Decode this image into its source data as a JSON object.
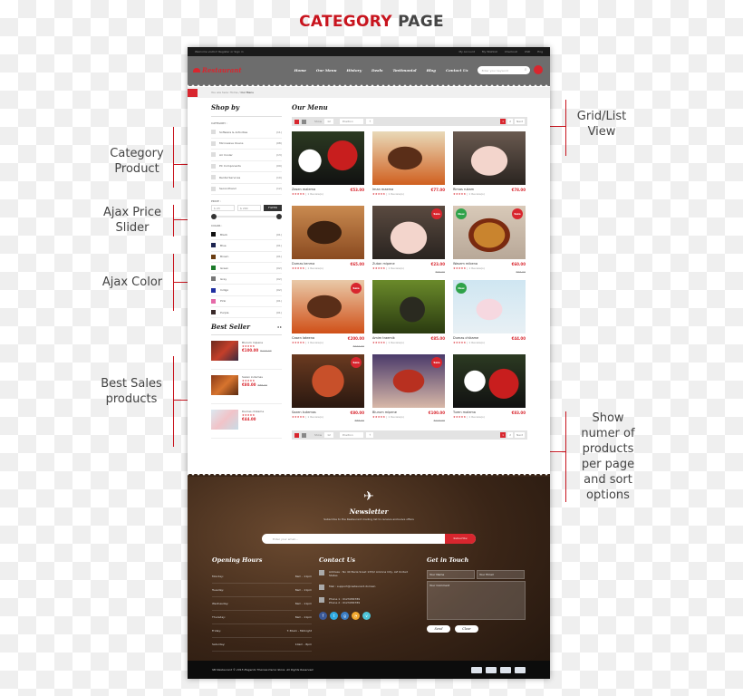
{
  "heading": {
    "part1": "CATEGORY",
    "part2": "PAGE"
  },
  "annotations": {
    "category": "Category Product",
    "price": "Ajax Price Slider",
    "color": "Ajax Color",
    "bestsales": "Best Sales products",
    "gridlist": "Grid/List View",
    "show": "Show numer of products per page and sort options"
  },
  "colors": {
    "accent": "#d8262e",
    "nav": "#6d6d6d",
    "topbar": "#1a1a1a"
  },
  "topbar": {
    "welcome": "Welcome visitor! Register or Sign in",
    "account": "My Account",
    "wishlist": "My Wishlist",
    "checkout": "Checkout",
    "currency": "USD",
    "language": "Eng"
  },
  "header": {
    "logo": "Restaurant",
    "nav": [
      "Home",
      "Our Menu",
      "History",
      "Deals",
      "Testimonial",
      "Blog",
      "Contact Us"
    ],
    "search_placeholder": "Enter your keyword"
  },
  "breadcrumb": {
    "prefix": "You are here:",
    "home": "Home",
    "current": "Our Menu"
  },
  "sidebar": {
    "title": "Shop by",
    "category_label": "CATEGORY :",
    "categories": [
      {
        "name": "Software & Activities",
        "count": "(11)"
      },
      {
        "name": "Microwave Ovens",
        "count": "(08)"
      },
      {
        "name": "Air Cooler",
        "count": "(13)"
      },
      {
        "name": "PC Components",
        "count": "(09)"
      },
      {
        "name": "Rental Services",
        "count": "(10)"
      },
      {
        "name": "Secondhand",
        "count": "(12)"
      }
    ],
    "price_label": "PRICE :",
    "price_min": "$ 23",
    "price_max": "$ 200",
    "filter": "FILTER",
    "color_label": "COLOR :",
    "colors": [
      {
        "name": "Black",
        "count": "(01)",
        "hex": "#111111"
      },
      {
        "name": "Blue",
        "count": "(01)",
        "hex": "#1c2450"
      },
      {
        "name": "Brown",
        "count": "(01)",
        "hex": "#6a3d12"
      },
      {
        "name": "Green",
        "count": "(02)",
        "hex": "#1c7a2a"
      },
      {
        "name": "Grey",
        "count": "(02)",
        "hex": "#777777"
      },
      {
        "name": "Indigo",
        "count": "(02)",
        "hex": "#1f2fa0"
      },
      {
        "name": "Pink",
        "count": "(01)",
        "hex": "#e56aa8"
      },
      {
        "name": "Purple",
        "count": "(01)",
        "hex": "#3a2a2a"
      }
    ],
    "bestseller_title": "Best Seller",
    "bestsellers": [
      {
        "name": "Blurum mipene",
        "stars": "★★★★★",
        "price": "€100.00",
        "old": "€123.00"
      },
      {
        "name": "Sazen kutemas",
        "stars": "★★★★★",
        "price": "€80.00",
        "old": "€88.00"
      },
      {
        "name": "Dumas chikame",
        "stars": "★★★★★",
        "price": "€44.00",
        "old": ""
      }
    ]
  },
  "main": {
    "title": "Our Menu",
    "toolbar": {
      "show_label": "Show",
      "per_page": "12",
      "sort": "Position",
      "pages": [
        "1",
        "2"
      ],
      "next": "Next"
    },
    "products": [
      {
        "name": "Zasen malema",
        "price": "€53.00",
        "old": "",
        "reviews": "1 Review(s)",
        "stars": "★★★★★",
        "badge": ""
      },
      {
        "name": "Iman maema",
        "price": "€77.00",
        "old": "",
        "reviews": "1 Review(s)",
        "stars": "★★★★★",
        "badge": ""
      },
      {
        "name": "Rimas rukam",
        "price": "€78.00",
        "old": "",
        "reviews": "1 Review(s)",
        "stars": "★★★★★",
        "badge": ""
      },
      {
        "name": "Dumas kenma",
        "price": "€65.00",
        "old": "",
        "reviews": "1 Review(s)",
        "stars": "★★★★★",
        "badge": ""
      },
      {
        "name": "Zutan mipene",
        "price": "€23.00",
        "old": "€33.00",
        "reviews": "1 Review(s)",
        "stars": "★★★★★",
        "badge": "sale"
      },
      {
        "name": "Wasem mibena",
        "price": "€60.00",
        "old": "€66.00",
        "reviews": "1 Review(s)",
        "stars": "★★★★★",
        "badge": "new-sale"
      },
      {
        "name": "Casen lateena",
        "price": "€200.00",
        "old": "€222.00",
        "reviews": "1 Review(s)",
        "stars": "★★★★★",
        "badge": "sale"
      },
      {
        "name": "Amim traemik",
        "price": "€85.00",
        "old": "",
        "reviews": "1 Review(s)",
        "stars": "★★★★★",
        "badge": ""
      },
      {
        "name": "Dumas chikame",
        "price": "€44.00",
        "old": "",
        "reviews": "1 Review(s)",
        "stars": "★★★★★",
        "badge": "new"
      },
      {
        "name": "Sazen kutemas",
        "price": "€80.00",
        "old": "€88.00",
        "reviews": "1 Review(s)",
        "stars": "★★★★★",
        "badge": "sale"
      },
      {
        "name": "Blurum mipene",
        "price": "€100.00",
        "old": "€123.00",
        "reviews": "1 Review(s)",
        "stars": "★★★★★",
        "badge": "sale"
      },
      {
        "name": "Turen malema",
        "price": "€83.00",
        "old": "",
        "reviews": "1 Review(s)",
        "stars": "★★★★★",
        "badge": ""
      }
    ],
    "badges": {
      "sale": "Sale",
      "new": "New"
    }
  },
  "footer": {
    "newsletter_title": "Newsletter",
    "newsletter_text": "Subscribe to the Restaurant mailing list to receive exclusive offers",
    "email_placeholder": "Enter your email...",
    "subscribe": "Subscribe",
    "hours_title": "Opening Hours",
    "hours": [
      {
        "day": "Monday:",
        "time": "8am - 11pm"
      },
      {
        "day": "Tuesday:",
        "time": "8am - 11pm"
      },
      {
        "day": "Wednesday:",
        "time": "8am - 11pm"
      },
      {
        "day": "Thursday:",
        "time": "8am - 11pm"
      },
      {
        "day": "Friday:",
        "time": "7:30am - Midnight"
      },
      {
        "day": "Saturday:",
        "time": "10am - 8pm"
      }
    ],
    "contact_title": "Contact Us",
    "address": "Address : No 40 Baria Sreet 133/2 Arizona City, AZ United States",
    "mail": "Mail : support@restaurant.domain",
    "phone1": "Phone 1 : 0123456789",
    "phone2": "Phone 2 : 0123456789",
    "social": [
      "f",
      "t",
      "g",
      "rss",
      "v"
    ],
    "touch_title": "Get in Touch",
    "name_placeholder": "Your Name",
    "email2_placeholder": "Your Email",
    "comment_placeholder": "Your Comment",
    "send": "Send",
    "clear": "Clear",
    "copyright": "SM Restaurant © 2015 Magento Themes Demo Store. All Rights Reserved."
  }
}
